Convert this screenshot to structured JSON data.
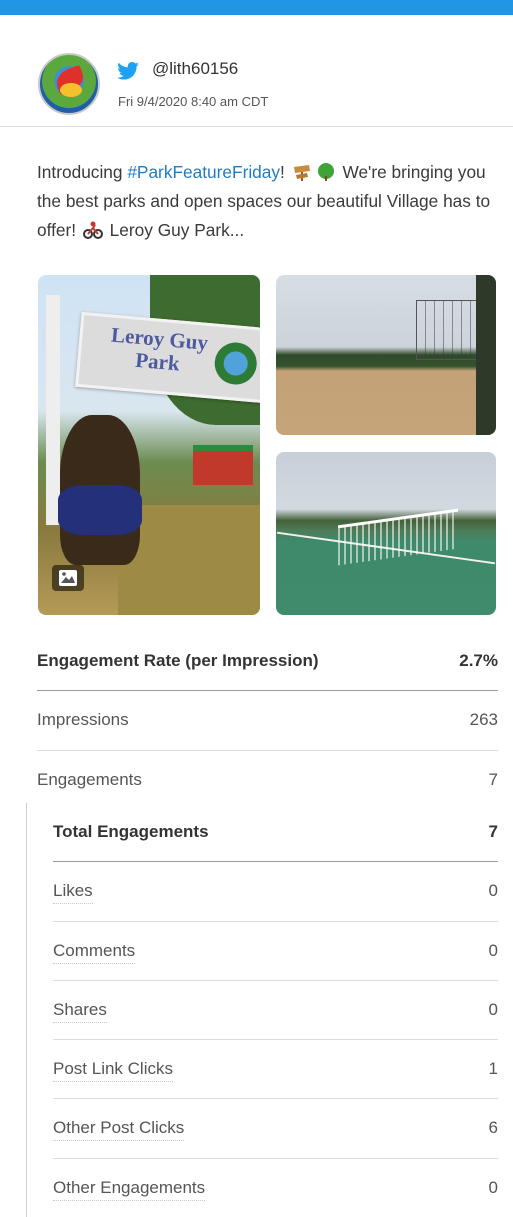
{
  "colors": {
    "accent_bar": "#2196e6",
    "hashtag": "#1f7cc4",
    "twitter": "#1da1f2"
  },
  "post": {
    "platform_icon": "twitter-icon",
    "handle": "@lith60156",
    "timestamp": "Fri 9/4/2020 8:40 am CDT",
    "text_before": "Introducing ",
    "hashtag": "#ParkFeatureFriday",
    "text_after_1": "! ",
    "text_after_2": " We're bringing you the best parks and open spaces our beautiful Village has to offer! ",
    "text_after_3": " Leroy Guy Park...",
    "emojis": [
      "sign-emoji",
      "tree-emoji",
      "bicycle-emoji"
    ],
    "photo_sign_text": "Leroy Guy Park"
  },
  "metrics": [
    {
      "label": "Engagement Rate (per Impression)",
      "value": "2.7%"
    },
    {
      "label": "Impressions",
      "value": "263"
    },
    {
      "label": "Engagements",
      "value": "7"
    }
  ],
  "engagement_breakdown": [
    {
      "label": "Total Engagements",
      "value": "7"
    },
    {
      "label": "Likes",
      "value": "0"
    },
    {
      "label": "Comments",
      "value": "0"
    },
    {
      "label": "Shares",
      "value": "0"
    },
    {
      "label": "Post Link Clicks",
      "value": "1"
    },
    {
      "label": "Other Post Clicks",
      "value": "6"
    },
    {
      "label": "Other Engagements",
      "value": "0"
    }
  ]
}
